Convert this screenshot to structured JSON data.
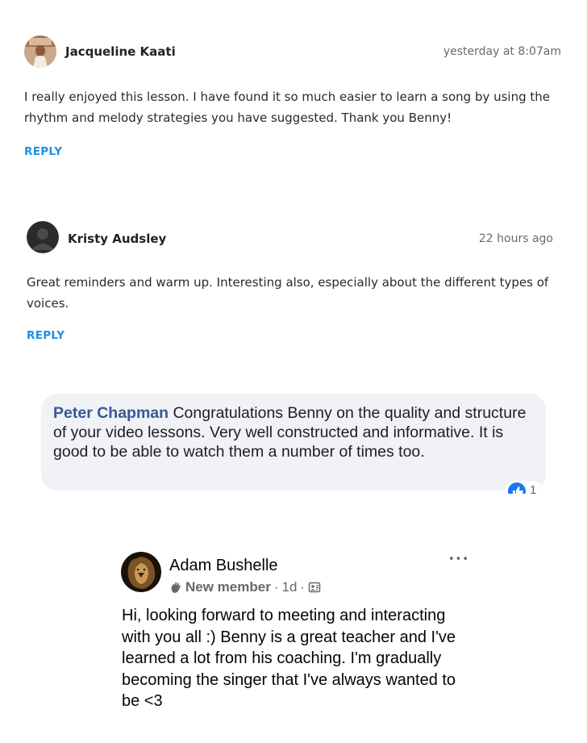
{
  "comments": [
    {
      "author": "Jacqueline Kaati",
      "time": "yesterday at 8:07am",
      "text": "I really enjoyed this lesson. I have found it so much easier to learn a song by using the rhythm and melody strategies you have suggested. Thank you Benny!",
      "reply_label": "REPLY"
    },
    {
      "author": "Kristy Audsley",
      "time": "22 hours ago",
      "text": "Great reminders and warm up. Interesting also, especially about the different types of voices.",
      "reply_label": "REPLY"
    }
  ],
  "fb_comment": {
    "author": "Peter Chapman",
    "text": "Congratulations Benny on the quality and structure of your video lessons. Very well constructed and informative. It is good to be able to watch them a number of times too.",
    "like_count": "1",
    "like_color": "#1877f2"
  },
  "group_post": {
    "author": "Adam Bushelle",
    "badge": "New member",
    "separator": "·",
    "time": "1d",
    "more_label": "•••",
    "text": "Hi, looking forward to meeting and interacting with you all :) Benny is a great teacher and I've learned a lot from his coaching. I'm gradually becoming the singer that I've always wanted to be <3"
  },
  "colors": {
    "reply_link": "#1e8fe6",
    "fb_author": "#385898",
    "bubble_bg": "#f0f2f5"
  }
}
